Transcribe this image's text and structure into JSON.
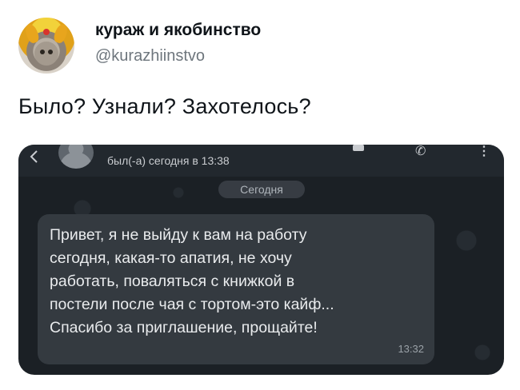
{
  "author": {
    "name": "кураж и якобинство",
    "handle": "@kurazhiinstvo"
  },
  "tweet": {
    "text": "Было? Узнали? Захотелось?"
  },
  "chat": {
    "status": "был(-а) сегодня в 13:38",
    "date_label": "Сегодня",
    "message_lines": [
      "Привет, я не выйду к вам на работу",
      "сегодня, какая-то апатия, не хочу",
      "работать, поваляться с книжкой в",
      "постели после чая с тортом-это кайф...",
      "Спасибо за приглашение, прощайте!"
    ],
    "time": "13:32"
  },
  "icons": {
    "back": "back-arrow-icon",
    "video": "video-call-icon",
    "call": "phone-icon",
    "more": "more-options-icon"
  }
}
